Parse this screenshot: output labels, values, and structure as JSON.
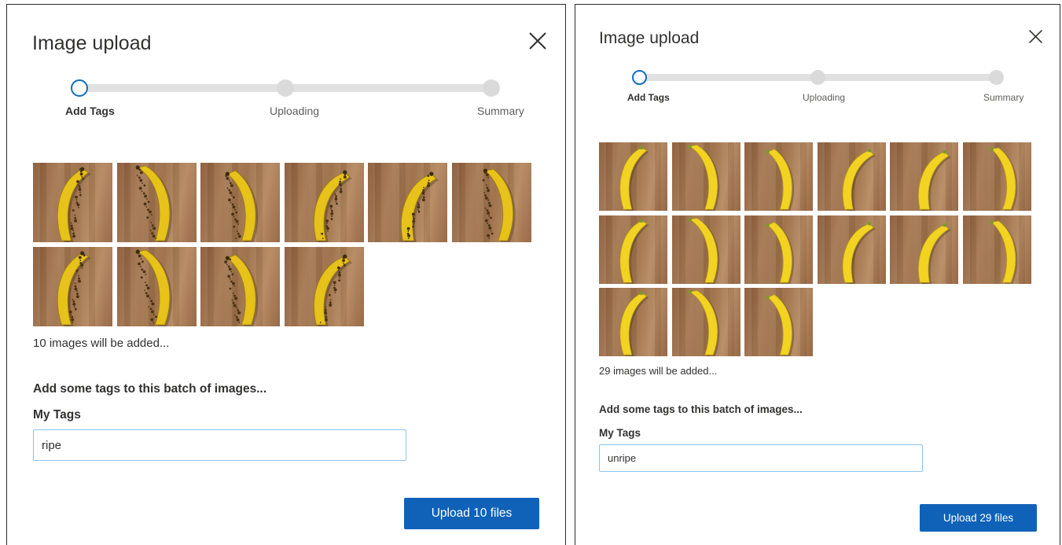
{
  "left_dialog": {
    "title": "Image upload",
    "steps": [
      {
        "label": "Add Tags",
        "active": true
      },
      {
        "label": "Uploading",
        "active": false
      },
      {
        "label": "Summary",
        "active": false
      }
    ],
    "image_count_text": "10 images will be added...",
    "prompt": "Add some tags to this batch of images...",
    "tags_label": "My Tags",
    "tags_value": "ripe",
    "upload_label": "Upload 10 files",
    "thumbnail_count": 10,
    "thumbnail_subject": "ripe spotted banana"
  },
  "right_dialog": {
    "title": "Image upload",
    "steps": [
      {
        "label": "Add Tags",
        "active": true
      },
      {
        "label": "Uploading",
        "active": false
      },
      {
        "label": "Summary",
        "active": false
      }
    ],
    "image_count_text": "29 images will be added...",
    "prompt": "Add some tags to this batch of images...",
    "tags_label": "My Tags",
    "tags_value": "unripe",
    "upload_label": "Upload 29 files",
    "thumbnail_count": 15,
    "thumbnail_subject": "unripe yellow banana"
  },
  "colors": {
    "primary": "#0f62b8",
    "step_active_ring": "#106ebe",
    "track": "#e1e1e1",
    "step_inactive": "#dadada",
    "input_border": "#8ac4f0",
    "banana_ripe": "#e6c21a",
    "banana_unripe": "#f2d321",
    "banana_spots": "#4a3214",
    "wood": "#a67a55"
  },
  "icons": {
    "close": "close-icon"
  }
}
